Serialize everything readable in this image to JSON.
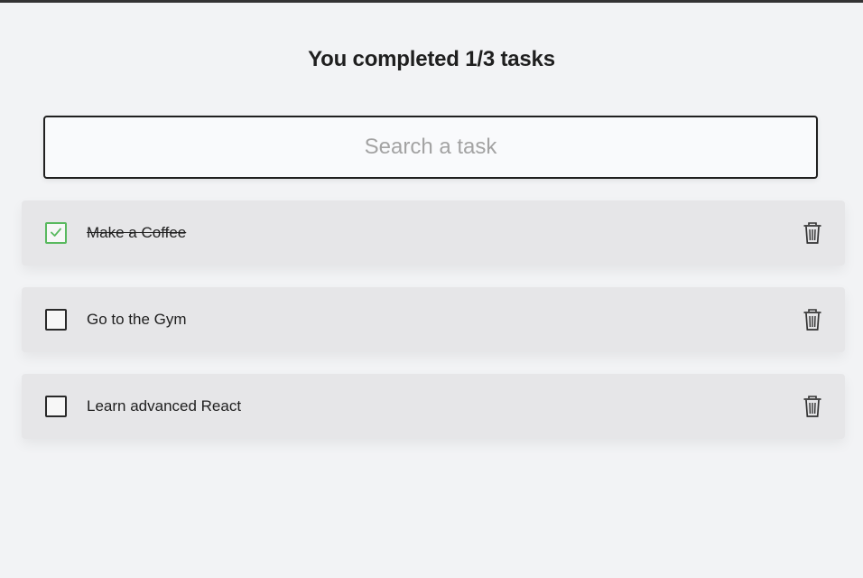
{
  "header": {
    "counter_text": "You completed 1/3 tasks"
  },
  "search": {
    "placeholder": "Search a task",
    "value": ""
  },
  "todos": [
    {
      "text": "Make a Coffee",
      "completed": true
    },
    {
      "text": "Go to the Gym",
      "completed": false
    },
    {
      "text": "Learn advanced React",
      "completed": false
    }
  ],
  "icons": {
    "check": "check-icon",
    "delete": "trash-icon"
  },
  "colors": {
    "background": "#f2f3f5",
    "item_background": "#e6e6e8",
    "check_accent": "#59b95f",
    "text": "#1f1f1f"
  }
}
